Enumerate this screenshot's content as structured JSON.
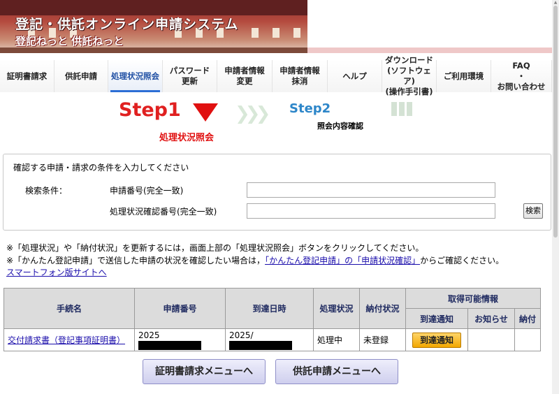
{
  "header": {
    "title": "登記・供託オンライン申請システム",
    "subtitle": "登記ねっと 供託ねっと"
  },
  "nav": {
    "items": [
      {
        "label": "証明書請求",
        "width": 78
      },
      {
        "label": "供託申請",
        "width": 77
      },
      {
        "label": "処理状況照会",
        "width": 78,
        "active": true
      },
      {
        "label": "パスワード\n更新",
        "width": 78
      },
      {
        "label": "申請者情報\n変更",
        "width": 79
      },
      {
        "label": "申請者情報\n抹消",
        "width": 79
      },
      {
        "label": "ヘルプ",
        "width": 78
      },
      {
        "label": "ダウンロード\n(ソフトウェア)\n(操作手引書)",
        "width": 78
      },
      {
        "label": "ご利用環境",
        "width": 78
      },
      {
        "label": "FAQ\n・\nお問い合わせ",
        "width": 87
      }
    ]
  },
  "steps": {
    "step1": "Step1",
    "step1_label": "処理状況照会",
    "step2": "Step2",
    "step2_label": "照会内容確認"
  },
  "search": {
    "caption": "確認する申請・請求の条件を入力してください",
    "condition_label": "検索条件：",
    "field1_label": "申請番号(完全一致)",
    "field1_value": "",
    "field2_label": "処理状況確認番号(完全一致)",
    "field2_value": "",
    "button": "検索"
  },
  "notes": {
    "note1": "※「処理状況」や「納付状況」を更新するには，画面上部の「処理状況照会」ボタンをクリックしてください。",
    "note2_prefix": "※「かんたん登記申請」で送信した申請の状況を確認したい場合は，",
    "note2_link": "「かんたん登記申請」の「申請状況確認」",
    "note2_suffix": "からご確認ください。",
    "smartphone_link": "スマートフォン版サイトへ"
  },
  "table": {
    "headers": {
      "procedure": "手続名",
      "application_no": "申請番号",
      "arrival_date": "到達日時",
      "status": "処理状況",
      "payment_status": "納付状況",
      "available_info": "取得可能情報",
      "arrival_notice": "到達通知",
      "notice": "お知らせ",
      "payment": "納付"
    },
    "rows": [
      {
        "procedure": "交付請求書（登記事項証明書）",
        "application_no": "2025",
        "arrival_date": "2025/",
        "status": "処理中",
        "payment_status": "未登録",
        "arrival_button": "到達通知"
      }
    ]
  },
  "buttons": {
    "certificate_menu": "証明書請求メニューへ",
    "deposit_menu": "供託申請メニューへ"
  }
}
